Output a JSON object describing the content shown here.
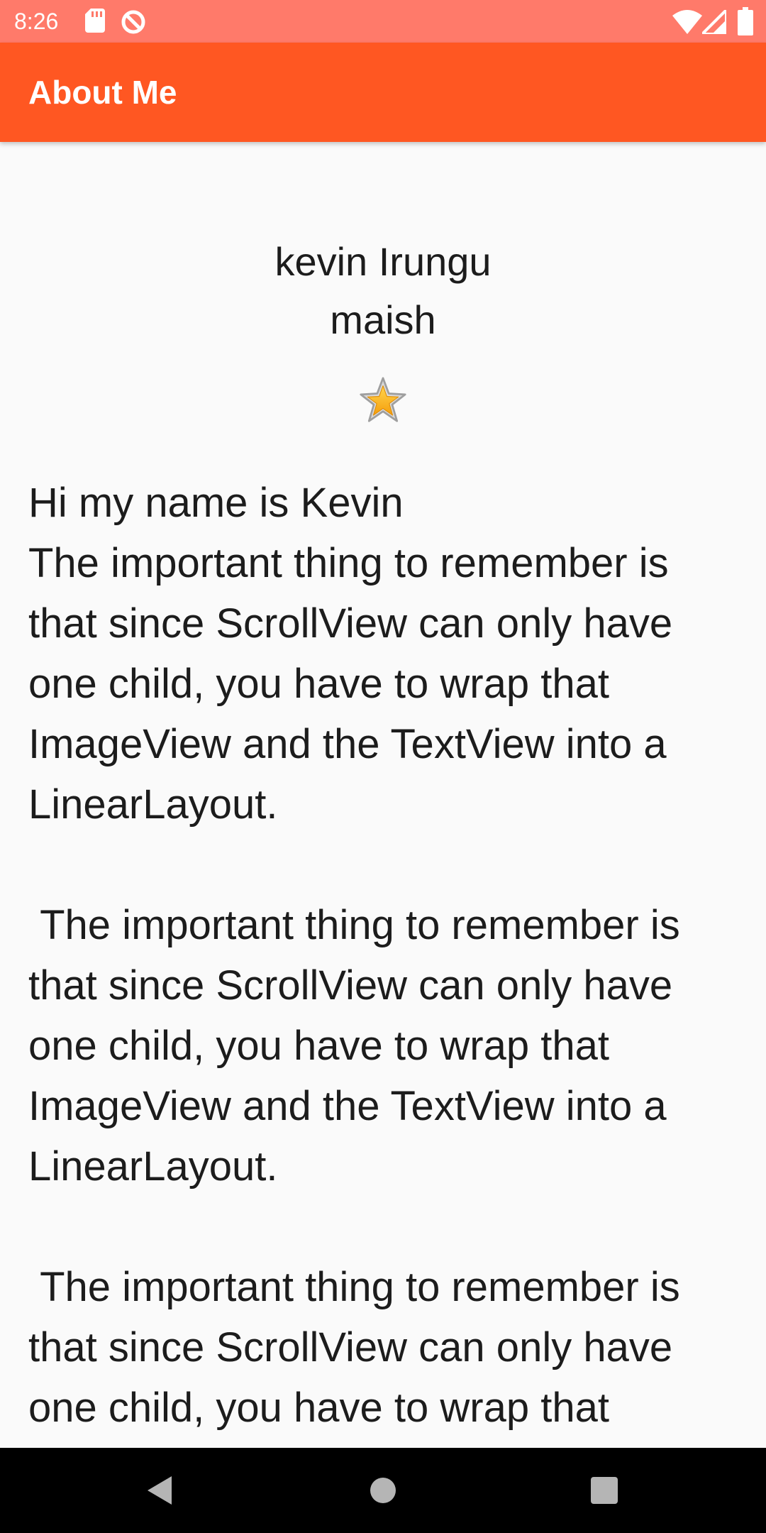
{
  "status_bar": {
    "time": "8:26",
    "left_icons": [
      "sd-card-icon",
      "data-saver-icon"
    ],
    "right_icons": [
      "wifi-icon",
      "signal-icon",
      "battery-icon"
    ],
    "background_color": "#ff7a6a"
  },
  "app_bar": {
    "title": "About Me",
    "background_color": "#ff5722"
  },
  "profile": {
    "name": "kevin Irungu",
    "nickname": "maish",
    "star_icon": "star-icon"
  },
  "bio": {
    "text": "Hi my name is Kevin\nThe important thing to remember is that since ScrollView can only have one child, you have to wrap that ImageView and the TextView into a LinearLayout.\n\n The important thing to remember is that since ScrollView can only have one child, you have to wrap that ImageView and the TextView into a LinearLayout.\n\n The important thing to remember is that since ScrollView can only have one child, you have to wrap that ImageView and the TextView into a LinearLayout."
  },
  "nav_bar": {
    "buttons": [
      "back-icon",
      "home-icon",
      "recents-icon"
    ]
  }
}
